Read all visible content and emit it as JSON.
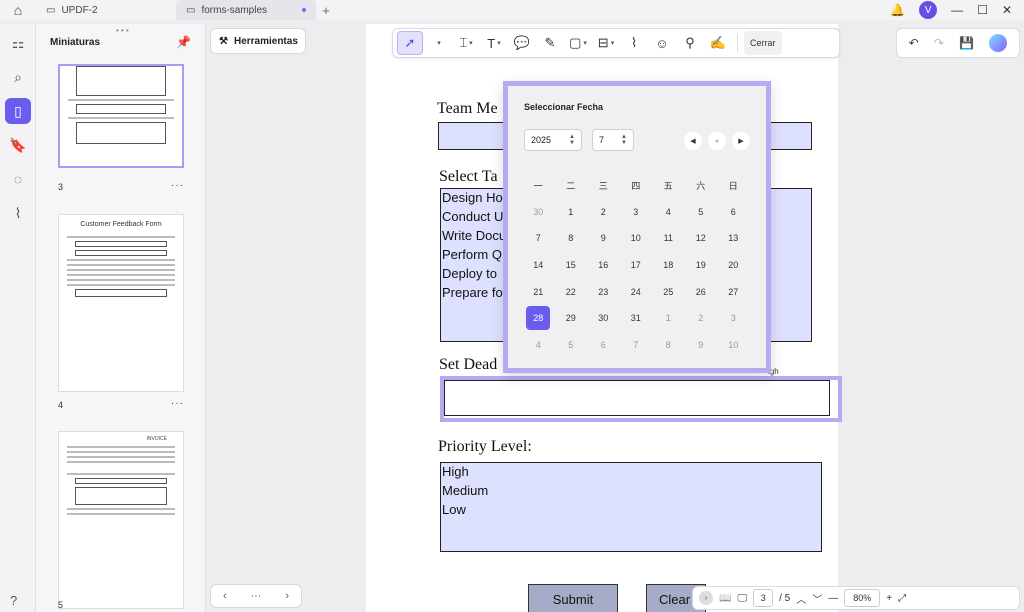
{
  "titlebar": {
    "tabs": [
      {
        "label": "UPDF-2"
      },
      {
        "label": "forms-samples"
      }
    ],
    "avatar_letter": "V"
  },
  "thumbnails": {
    "title": "Miniaturas",
    "pages": [
      {
        "number": "3"
      },
      {
        "number": "4",
        "mini_title": "Customer Feedback Form"
      },
      {
        "number": "5",
        "mini_title": "INVOICE"
      }
    ]
  },
  "strip": {
    "tools_label": "Herramientas"
  },
  "toolbar": {
    "close_label": "Cerrar"
  },
  "document": {
    "team_label": "Team Me",
    "tasks_label": "Select Ta",
    "tasks": [
      "Design Ho",
      "Conduct U",
      "Write Docu",
      "Perform Q",
      "Deploy to",
      "Prepare fo"
    ],
    "deadline_label": "Set Dead",
    "high_fragment": "igh",
    "priority_label": "Priority Level:",
    "priority_options": [
      "High",
      "Medium",
      "Low"
    ],
    "submit_label": "Submit",
    "clear_label": "Clear"
  },
  "datepicker": {
    "title": "Seleccionar Fecha",
    "year": "2025",
    "month": "7",
    "weekdays": [
      "一",
      "二",
      "三",
      "四",
      "五",
      "六",
      "日"
    ],
    "days": [
      [
        "30",
        "1",
        "2",
        "3",
        "4",
        "5",
        "6"
      ],
      [
        "7",
        "8",
        "9",
        "10",
        "11",
        "12",
        "13"
      ],
      [
        "14",
        "15",
        "16",
        "17",
        "18",
        "19",
        "20"
      ],
      [
        "21",
        "22",
        "23",
        "24",
        "25",
        "26",
        "27"
      ],
      [
        "28",
        "29",
        "30",
        "31",
        "1",
        "2",
        "3"
      ],
      [
        "4",
        "5",
        "6",
        "7",
        "8",
        "9",
        "10"
      ]
    ],
    "selected_day": "28"
  },
  "status": {
    "page": "3",
    "total": "/ 5",
    "zoom": "80%"
  }
}
